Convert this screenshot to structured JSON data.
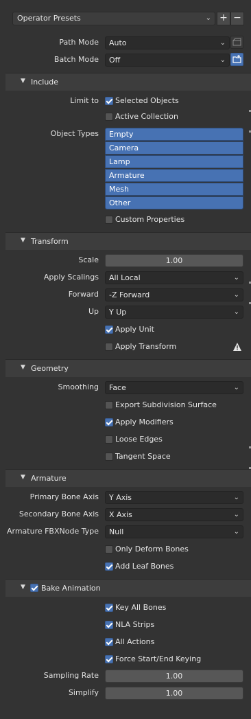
{
  "presets": {
    "label": "Operator Presets",
    "add_label": "+",
    "remove_label": "−"
  },
  "path_mode": {
    "label": "Path Mode",
    "value": "Auto"
  },
  "batch_mode": {
    "label": "Batch Mode",
    "value": "Off"
  },
  "include": {
    "title": "Include",
    "limit_to_label": "Limit to",
    "selected_objects": {
      "label": "Selected Objects",
      "checked": true
    },
    "active_collection": {
      "label": "Active Collection",
      "checked": false
    },
    "object_types_label": "Object Types",
    "object_types": [
      "Empty",
      "Camera",
      "Lamp",
      "Armature",
      "Mesh",
      "Other"
    ],
    "custom_properties": {
      "label": "Custom Properties",
      "checked": false
    }
  },
  "transform": {
    "title": "Transform",
    "scale": {
      "label": "Scale",
      "value": "1.00"
    },
    "apply_scalings": {
      "label": "Apply Scalings",
      "value": "All Local"
    },
    "forward": {
      "label": "Forward",
      "value": "-Z Forward"
    },
    "up": {
      "label": "Up",
      "value": "Y Up"
    },
    "apply_unit": {
      "label": "Apply Unit",
      "checked": true
    },
    "apply_transform": {
      "label": "Apply Transform",
      "checked": false
    }
  },
  "geometry": {
    "title": "Geometry",
    "smoothing": {
      "label": "Smoothing",
      "value": "Face"
    },
    "export_subdivision": {
      "label": "Export Subdivision Surface",
      "checked": false
    },
    "apply_modifiers": {
      "label": "Apply Modifiers",
      "checked": true
    },
    "loose_edges": {
      "label": "Loose Edges",
      "checked": false
    },
    "tangent_space": {
      "label": "Tangent Space",
      "checked": false
    }
  },
  "armature": {
    "title": "Armature",
    "primary_bone_axis": {
      "label": "Primary Bone Axis",
      "value": "Y Axis"
    },
    "secondary_bone_axis": {
      "label": "Secondary Bone Axis",
      "value": "X Axis"
    },
    "armature_fbx_node_type": {
      "label": "Armature FBXNode Type",
      "value": "Null"
    },
    "only_deform_bones": {
      "label": "Only Deform Bones",
      "checked": false
    },
    "add_leaf_bones": {
      "label": "Add Leaf Bones",
      "checked": true
    }
  },
  "bake_animation": {
    "title": "Bake Animation",
    "checked": true,
    "key_all_bones": {
      "label": "Key All Bones",
      "checked": true
    },
    "nla_strips": {
      "label": "NLA Strips",
      "checked": true
    },
    "all_actions": {
      "label": "All Actions",
      "checked": true
    },
    "force_keying": {
      "label": "Force Start/End Keying",
      "checked": true
    },
    "sampling_rate": {
      "label": "Sampling Rate",
      "value": "1.00"
    },
    "simplify": {
      "label": "Simplify",
      "value": "1.00"
    }
  },
  "colors": {
    "background": "#333333",
    "accent": "#4772b3",
    "header": "#3d3d3d"
  },
  "icons": [
    "chevron-down-icon",
    "plus-icon",
    "minus-icon",
    "folder-icon",
    "warning-icon",
    "disclosure-triangle-icon",
    "checkmark-icon"
  ]
}
